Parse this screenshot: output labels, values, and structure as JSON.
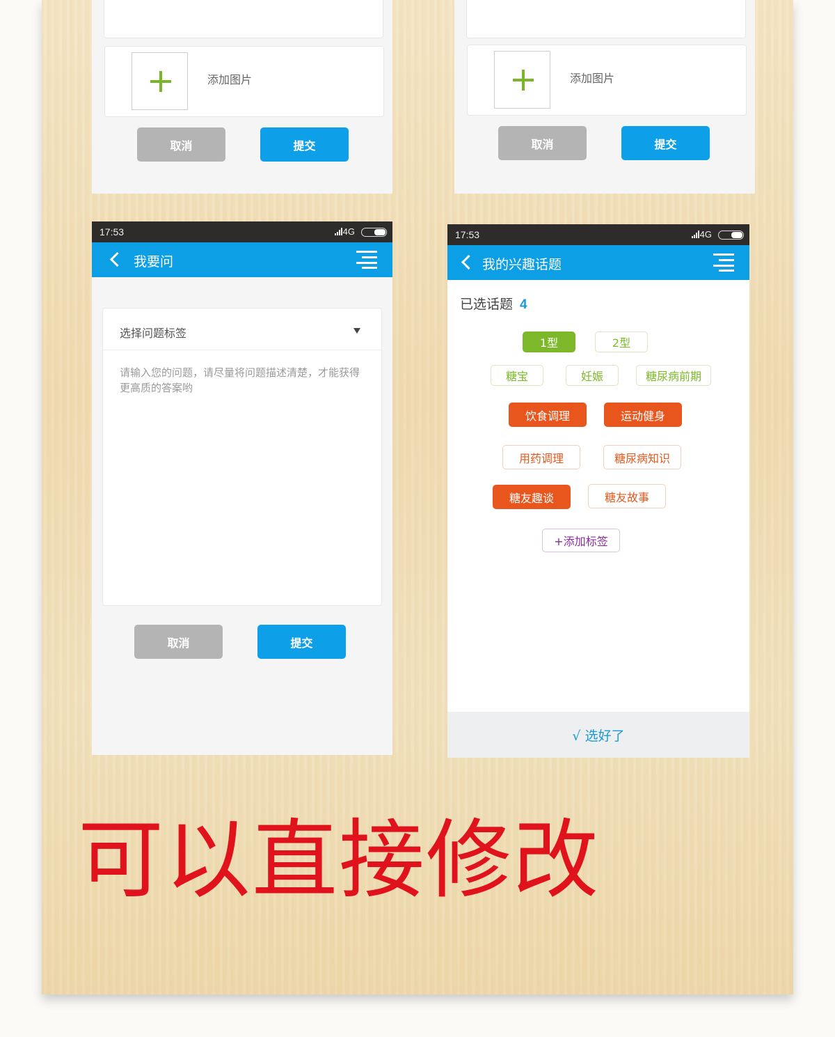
{
  "top_left_phone": {
    "add_image_label": "添加图片",
    "cancel_label": "取消",
    "submit_label": "提交"
  },
  "top_right_phone": {
    "add_image_label": "添加图片",
    "cancel_label": "取消",
    "submit_label": "提交"
  },
  "ask_phone": {
    "status": {
      "time": "17:53",
      "network": "4G"
    },
    "header": {
      "title": "我要问"
    },
    "tag_select": {
      "selected": "选择问题标签"
    },
    "question_input": {
      "placeholder": "请输入您的问题，请尽量将问题描述清楚，才能获得更高质的答案哟",
      "value": ""
    },
    "cancel_label": "取消",
    "submit_label": "提交"
  },
  "topics_phone": {
    "status": {
      "time": "17:53",
      "network": "4G"
    },
    "header": {
      "title": "我的兴趣话题"
    },
    "selected_label": "已选话题",
    "selected_count": "4",
    "tags": [
      {
        "label": "1型",
        "selected": true
      },
      {
        "label": "2型",
        "selected": false
      },
      {
        "label": "糖宝",
        "selected": false
      },
      {
        "label": "妊娠",
        "selected": false
      },
      {
        "label": "糖尿病前期",
        "selected": false
      },
      {
        "label": "饮食调理",
        "selected": true
      },
      {
        "label": "运动健身",
        "selected": true
      },
      {
        "label": "用药调理",
        "selected": false
      },
      {
        "label": "糖尿病知识",
        "selected": false
      },
      {
        "label": "糖友趣谈",
        "selected": true
      },
      {
        "label": "糖友故事",
        "selected": false
      }
    ],
    "add_tag_label": "+添加标签",
    "done_label": "√ 选好了"
  },
  "slogan": "可以直接修改",
  "colors": {
    "primary_blue": "#0c9fe6",
    "green_tag": "#7cb82a",
    "orange_tag": "#e8561e",
    "slogan_red": "#e0121c",
    "add_tag_purple": "#8a2d9a"
  }
}
